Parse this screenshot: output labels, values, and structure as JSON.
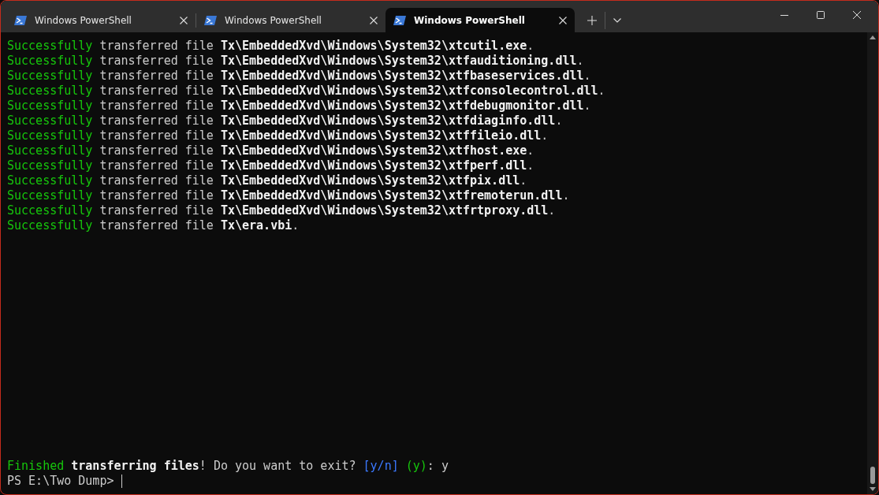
{
  "tabs": [
    {
      "label": "Windows PowerShell",
      "selected": false
    },
    {
      "label": "Windows PowerShell",
      "selected": false
    },
    {
      "label": "Windows PowerShell",
      "selected": true
    }
  ],
  "output": [
    [
      {
        "kind": "success",
        "text": "Successfully"
      },
      {
        "kind": "plain",
        "text": " transferred file "
      },
      {
        "kind": "path",
        "text": "Tx\\EmbeddedXvd\\Windows\\System32\\xtcutil.exe"
      },
      {
        "kind": "plain",
        "text": "."
      }
    ],
    [
      {
        "kind": "success",
        "text": "Successfully"
      },
      {
        "kind": "plain",
        "text": " transferred file "
      },
      {
        "kind": "path",
        "text": "Tx\\EmbeddedXvd\\Windows\\System32\\xtfauditioning.dll"
      },
      {
        "kind": "plain",
        "text": "."
      }
    ],
    [
      {
        "kind": "success",
        "text": "Successfully"
      },
      {
        "kind": "plain",
        "text": " transferred file "
      },
      {
        "kind": "path",
        "text": "Tx\\EmbeddedXvd\\Windows\\System32\\xtfbaseservices.dll"
      },
      {
        "kind": "plain",
        "text": "."
      }
    ],
    [
      {
        "kind": "success",
        "text": "Successfully"
      },
      {
        "kind": "plain",
        "text": " transferred file "
      },
      {
        "kind": "path",
        "text": "Tx\\EmbeddedXvd\\Windows\\System32\\xtfconsolecontrol.dll"
      },
      {
        "kind": "plain",
        "text": "."
      }
    ],
    [
      {
        "kind": "success",
        "text": "Successfully"
      },
      {
        "kind": "plain",
        "text": " transferred file "
      },
      {
        "kind": "path",
        "text": "Tx\\EmbeddedXvd\\Windows\\System32\\xtfdebugmonitor.dll"
      },
      {
        "kind": "plain",
        "text": "."
      }
    ],
    [
      {
        "kind": "success",
        "text": "Successfully"
      },
      {
        "kind": "plain",
        "text": " transferred file "
      },
      {
        "kind": "path",
        "text": "Tx\\EmbeddedXvd\\Windows\\System32\\xtfdiaginfo.dll"
      },
      {
        "kind": "plain",
        "text": "."
      }
    ],
    [
      {
        "kind": "success",
        "text": "Successfully"
      },
      {
        "kind": "plain",
        "text": " transferred file "
      },
      {
        "kind": "path",
        "text": "Tx\\EmbeddedXvd\\Windows\\System32\\xtffileio.dll"
      },
      {
        "kind": "plain",
        "text": "."
      }
    ],
    [
      {
        "kind": "success",
        "text": "Successfully"
      },
      {
        "kind": "plain",
        "text": " transferred file "
      },
      {
        "kind": "path",
        "text": "Tx\\EmbeddedXvd\\Windows\\System32\\xtfhost.exe"
      },
      {
        "kind": "plain",
        "text": "."
      }
    ],
    [
      {
        "kind": "success",
        "text": "Successfully"
      },
      {
        "kind": "plain",
        "text": " transferred file "
      },
      {
        "kind": "path",
        "text": "Tx\\EmbeddedXvd\\Windows\\System32\\xtfperf.dll"
      },
      {
        "kind": "plain",
        "text": "."
      }
    ],
    [
      {
        "kind": "success",
        "text": "Successfully"
      },
      {
        "kind": "plain",
        "text": " transferred file "
      },
      {
        "kind": "path",
        "text": "Tx\\EmbeddedXvd\\Windows\\System32\\xtfpix.dll"
      },
      {
        "kind": "plain",
        "text": "."
      }
    ],
    [
      {
        "kind": "success",
        "text": "Successfully"
      },
      {
        "kind": "plain",
        "text": " transferred file "
      },
      {
        "kind": "path",
        "text": "Tx\\EmbeddedXvd\\Windows\\System32\\xtfremoterun.dll"
      },
      {
        "kind": "plain",
        "text": "."
      }
    ],
    [
      {
        "kind": "success",
        "text": "Successfully"
      },
      {
        "kind": "plain",
        "text": " transferred file "
      },
      {
        "kind": "path",
        "text": "Tx\\EmbeddedXvd\\Windows\\System32\\xtfrtproxy.dll"
      },
      {
        "kind": "plain",
        "text": "."
      }
    ],
    [
      {
        "kind": "success",
        "text": "Successfully"
      },
      {
        "kind": "plain",
        "text": " transferred file "
      },
      {
        "kind": "path",
        "text": "Tx\\era.vbi"
      },
      {
        "kind": "plain",
        "text": "."
      }
    ]
  ],
  "footer": [
    [
      {
        "kind": "success",
        "text": "Finished "
      },
      {
        "kind": "path",
        "text": "transferring files"
      },
      {
        "kind": "plain",
        "text": "! Do you want to exit? "
      },
      {
        "kind": "choice",
        "text": "[y/n] "
      },
      {
        "kind": "success",
        "text": "(y)"
      },
      {
        "kind": "plain",
        "text": ": y"
      }
    ],
    [
      {
        "kind": "plain",
        "text": "PS E:\\Two Dump> "
      }
    ]
  ]
}
